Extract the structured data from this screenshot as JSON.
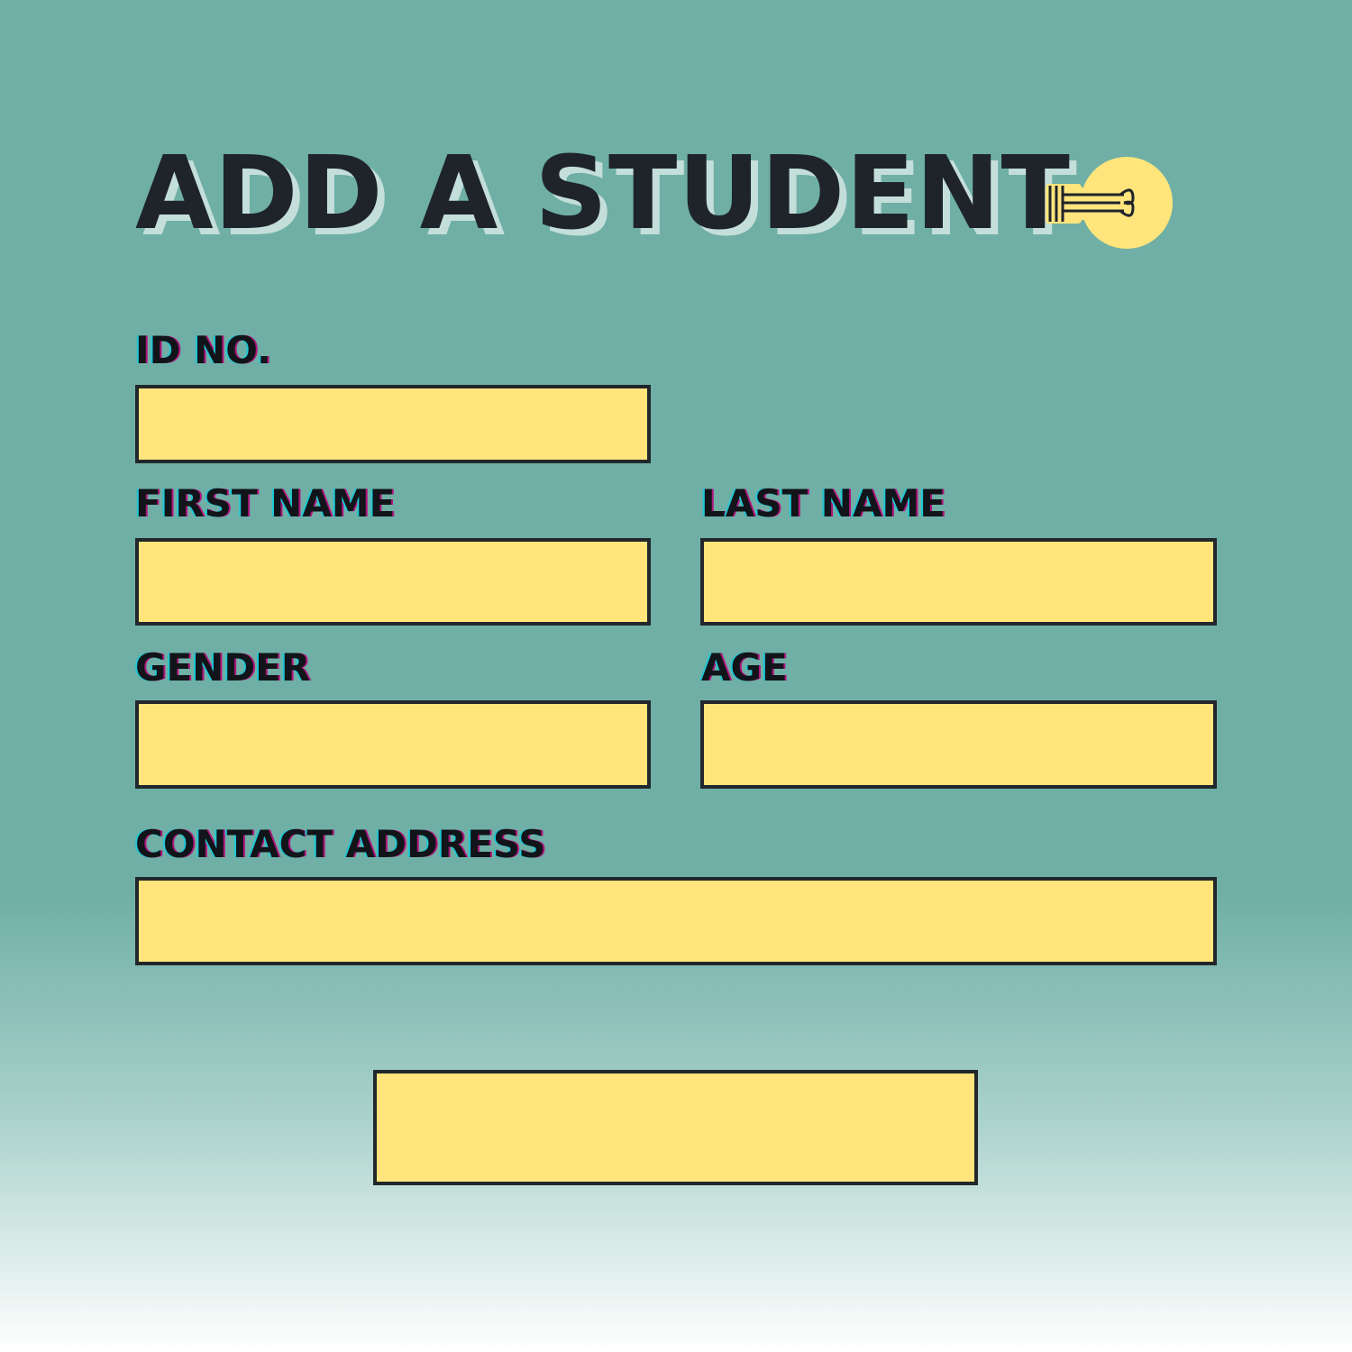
{
  "header": {
    "title": "ADD A STUDENT",
    "icon": "lightbulb-icon"
  },
  "form": {
    "id_no": {
      "label": "ID NO.",
      "value": ""
    },
    "first_name": {
      "label": "FIRST NAME",
      "value": ""
    },
    "last_name": {
      "label": "LAST NAME",
      "value": ""
    },
    "gender": {
      "label": "GENDER",
      "value": ""
    },
    "age": {
      "label": "AGE",
      "value": ""
    },
    "contact_address": {
      "label": "CONTACT ADDRESS",
      "value": ""
    },
    "submit_label": ""
  },
  "colors": {
    "background": "#6fafa6",
    "field_fill": "#ffe57c",
    "field_border": "#22272b",
    "text": "#1f242b",
    "title_shadow": "#c4ded9",
    "bulb": "#ffe57c"
  }
}
